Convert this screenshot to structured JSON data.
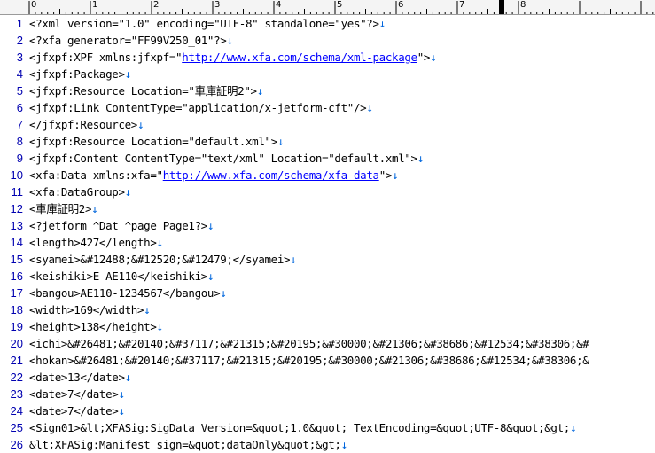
{
  "ruler": {
    "labels": [
      "0",
      "1",
      "2",
      "3",
      "4",
      "5",
      "6",
      "7",
      "8"
    ]
  },
  "lines": [
    {
      "n": "1",
      "segs": [
        {
          "t": "<?xml version=\"1.0\" encoding=\"UTF-8\" standalone=\"yes\"?>"
        }
      ],
      "eol": "↓"
    },
    {
      "n": "2",
      "segs": [
        {
          "t": "<?xfa generator=\"FF99V250_01\"?>"
        }
      ],
      "eol": "↓"
    },
    {
      "n": "3",
      "segs": [
        {
          "t": "<jfxpf:XPF xmlns:jfxpf=\""
        },
        {
          "t": "http://www.xfa.com/schema/xml-package",
          "link": true
        },
        {
          "t": "\">"
        }
      ],
      "eol": "↓"
    },
    {
      "n": "4",
      "segs": [
        {
          "t": "<jfxpf:Package>"
        }
      ],
      "eol": "↓"
    },
    {
      "n": "5",
      "segs": [
        {
          "t": "<jfxpf:Resource Location=\"車庫証明2\">"
        }
      ],
      "eol": "↓"
    },
    {
      "n": "6",
      "segs": [
        {
          "t": "<jfxpf:Link ContentType=\"application/x-jetform-cft\"/>"
        }
      ],
      "eol": "↓"
    },
    {
      "n": "7",
      "segs": [
        {
          "t": "</jfxpf:Resource>"
        }
      ],
      "eol": "↓"
    },
    {
      "n": "8",
      "segs": [
        {
          "t": "<jfxpf:Resource Location=\"default.xml\">"
        }
      ],
      "eol": "↓"
    },
    {
      "n": "9",
      "segs": [
        {
          "t": "<jfxpf:Content ContentType=\"text/xml\" Location=\"default.xml\">"
        }
      ],
      "eol": "↓"
    },
    {
      "n": "10",
      "segs": [
        {
          "t": "<xfa:Data xmlns:xfa=\""
        },
        {
          "t": "http://www.xfa.com/schema/xfa-data",
          "link": true
        },
        {
          "t": "\">"
        }
      ],
      "eol": "↓"
    },
    {
      "n": "11",
      "segs": [
        {
          "t": "<xfa:DataGroup>"
        }
      ],
      "eol": "↓"
    },
    {
      "n": "12",
      "segs": [
        {
          "t": "<車庫証明2>"
        }
      ],
      "eol": "↓"
    },
    {
      "n": "13",
      "segs": [
        {
          "t": "<?jetform ^Dat ^page Page1?>"
        }
      ],
      "eol": "↓"
    },
    {
      "n": "14",
      "segs": [
        {
          "t": "<length>427</length>"
        }
      ],
      "eol": "↓"
    },
    {
      "n": "15",
      "segs": [
        {
          "t": "<syamei>&#12488;&#12520;&#12479;</syamei>"
        }
      ],
      "eol": "↓"
    },
    {
      "n": "16",
      "segs": [
        {
          "t": "<keishiki>E-AE110</keishiki>"
        }
      ],
      "eol": "↓"
    },
    {
      "n": "17",
      "segs": [
        {
          "t": "<bangou>AE110-1234567</bangou>"
        }
      ],
      "eol": "↓"
    },
    {
      "n": "18",
      "segs": [
        {
          "t": "<width>169</width>"
        }
      ],
      "eol": "↓"
    },
    {
      "n": "19",
      "segs": [
        {
          "t": "<height>138</height>"
        }
      ],
      "eol": "↓"
    },
    {
      "n": "20",
      "segs": [
        {
          "t": "<ichi>&#26481;&#20140;&#37117;&#21315;&#20195;&#30000;&#21306;&#38686;&#12534;&#38306;&#"
        }
      ],
      "eol": ""
    },
    {
      "n": "21",
      "segs": [
        {
          "t": "<hokan>&#26481;&#20140;&#37117;&#21315;&#20195;&#30000;&#21306;&#38686;&#12534;&#38306;&"
        }
      ],
      "eol": ""
    },
    {
      "n": "22",
      "segs": [
        {
          "t": "<date>13</date>"
        }
      ],
      "eol": "↓"
    },
    {
      "n": "23",
      "segs": [
        {
          "t": "<date>7</date>"
        }
      ],
      "eol": "↓"
    },
    {
      "n": "24",
      "segs": [
        {
          "t": "<date>7</date>"
        }
      ],
      "eol": "↓"
    },
    {
      "n": "25",
      "segs": [
        {
          "t": "<Sign01>&lt;XFASig:SigData Version=&quot;1.0&quot; TextEncoding=&quot;UTF-8&quot;&gt;"
        }
      ],
      "eol": "↓"
    },
    {
      "n": "26",
      "segs": [
        {
          "t": "&lt;XFASig:Manifest sign=&quot;dataOnly&quot;&gt;"
        }
      ],
      "eol": "↓"
    }
  ]
}
